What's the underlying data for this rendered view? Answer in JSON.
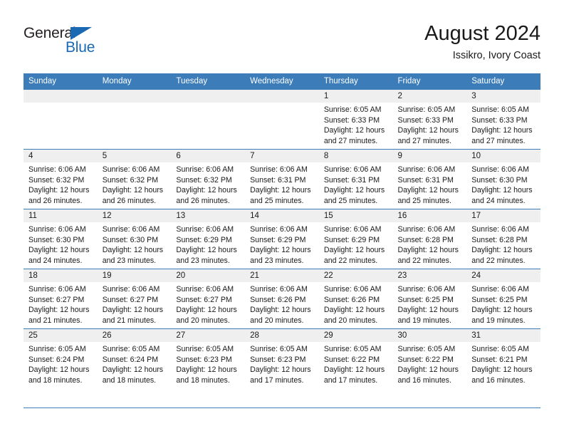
{
  "brand": {
    "name_part1": "General",
    "name_part2": "Blue",
    "color_dark": "#231f20",
    "color_blue": "#1b68b3"
  },
  "header": {
    "title": "August 2024",
    "subtitle": "Issikro, Ivory Coast"
  },
  "theme": {
    "header_row_bg": "#3b7cb9",
    "daynum_bg": "#efefef",
    "rule_color": "#3b7cb9",
    "text_color": "#1a1a1a"
  },
  "weekdays": [
    "Sunday",
    "Monday",
    "Tuesday",
    "Wednesday",
    "Thursday",
    "Friday",
    "Saturday"
  ],
  "weeks": [
    [
      {
        "day": "",
        "sunrise": "",
        "sunset": "",
        "daylight1": "",
        "daylight2": ""
      },
      {
        "day": "",
        "sunrise": "",
        "sunset": "",
        "daylight1": "",
        "daylight2": ""
      },
      {
        "day": "",
        "sunrise": "",
        "sunset": "",
        "daylight1": "",
        "daylight2": ""
      },
      {
        "day": "",
        "sunrise": "",
        "sunset": "",
        "daylight1": "",
        "daylight2": ""
      },
      {
        "day": "1",
        "sunrise": "Sunrise: 6:05 AM",
        "sunset": "Sunset: 6:33 PM",
        "daylight1": "Daylight: 12 hours",
        "daylight2": "and 27 minutes."
      },
      {
        "day": "2",
        "sunrise": "Sunrise: 6:05 AM",
        "sunset": "Sunset: 6:33 PM",
        "daylight1": "Daylight: 12 hours",
        "daylight2": "and 27 minutes."
      },
      {
        "day": "3",
        "sunrise": "Sunrise: 6:05 AM",
        "sunset": "Sunset: 6:33 PM",
        "daylight1": "Daylight: 12 hours",
        "daylight2": "and 27 minutes."
      }
    ],
    [
      {
        "day": "4",
        "sunrise": "Sunrise: 6:06 AM",
        "sunset": "Sunset: 6:32 PM",
        "daylight1": "Daylight: 12 hours",
        "daylight2": "and 26 minutes."
      },
      {
        "day": "5",
        "sunrise": "Sunrise: 6:06 AM",
        "sunset": "Sunset: 6:32 PM",
        "daylight1": "Daylight: 12 hours",
        "daylight2": "and 26 minutes."
      },
      {
        "day": "6",
        "sunrise": "Sunrise: 6:06 AM",
        "sunset": "Sunset: 6:32 PM",
        "daylight1": "Daylight: 12 hours",
        "daylight2": "and 26 minutes."
      },
      {
        "day": "7",
        "sunrise": "Sunrise: 6:06 AM",
        "sunset": "Sunset: 6:31 PM",
        "daylight1": "Daylight: 12 hours",
        "daylight2": "and 25 minutes."
      },
      {
        "day": "8",
        "sunrise": "Sunrise: 6:06 AM",
        "sunset": "Sunset: 6:31 PM",
        "daylight1": "Daylight: 12 hours",
        "daylight2": "and 25 minutes."
      },
      {
        "day": "9",
        "sunrise": "Sunrise: 6:06 AM",
        "sunset": "Sunset: 6:31 PM",
        "daylight1": "Daylight: 12 hours",
        "daylight2": "and 25 minutes."
      },
      {
        "day": "10",
        "sunrise": "Sunrise: 6:06 AM",
        "sunset": "Sunset: 6:30 PM",
        "daylight1": "Daylight: 12 hours",
        "daylight2": "and 24 minutes."
      }
    ],
    [
      {
        "day": "11",
        "sunrise": "Sunrise: 6:06 AM",
        "sunset": "Sunset: 6:30 PM",
        "daylight1": "Daylight: 12 hours",
        "daylight2": "and 24 minutes."
      },
      {
        "day": "12",
        "sunrise": "Sunrise: 6:06 AM",
        "sunset": "Sunset: 6:30 PM",
        "daylight1": "Daylight: 12 hours",
        "daylight2": "and 23 minutes."
      },
      {
        "day": "13",
        "sunrise": "Sunrise: 6:06 AM",
        "sunset": "Sunset: 6:29 PM",
        "daylight1": "Daylight: 12 hours",
        "daylight2": "and 23 minutes."
      },
      {
        "day": "14",
        "sunrise": "Sunrise: 6:06 AM",
        "sunset": "Sunset: 6:29 PM",
        "daylight1": "Daylight: 12 hours",
        "daylight2": "and 23 minutes."
      },
      {
        "day": "15",
        "sunrise": "Sunrise: 6:06 AM",
        "sunset": "Sunset: 6:29 PM",
        "daylight1": "Daylight: 12 hours",
        "daylight2": "and 22 minutes."
      },
      {
        "day": "16",
        "sunrise": "Sunrise: 6:06 AM",
        "sunset": "Sunset: 6:28 PM",
        "daylight1": "Daylight: 12 hours",
        "daylight2": "and 22 minutes."
      },
      {
        "day": "17",
        "sunrise": "Sunrise: 6:06 AM",
        "sunset": "Sunset: 6:28 PM",
        "daylight1": "Daylight: 12 hours",
        "daylight2": "and 22 minutes."
      }
    ],
    [
      {
        "day": "18",
        "sunrise": "Sunrise: 6:06 AM",
        "sunset": "Sunset: 6:27 PM",
        "daylight1": "Daylight: 12 hours",
        "daylight2": "and 21 minutes."
      },
      {
        "day": "19",
        "sunrise": "Sunrise: 6:06 AM",
        "sunset": "Sunset: 6:27 PM",
        "daylight1": "Daylight: 12 hours",
        "daylight2": "and 21 minutes."
      },
      {
        "day": "20",
        "sunrise": "Sunrise: 6:06 AM",
        "sunset": "Sunset: 6:27 PM",
        "daylight1": "Daylight: 12 hours",
        "daylight2": "and 20 minutes."
      },
      {
        "day": "21",
        "sunrise": "Sunrise: 6:06 AM",
        "sunset": "Sunset: 6:26 PM",
        "daylight1": "Daylight: 12 hours",
        "daylight2": "and 20 minutes."
      },
      {
        "day": "22",
        "sunrise": "Sunrise: 6:06 AM",
        "sunset": "Sunset: 6:26 PM",
        "daylight1": "Daylight: 12 hours",
        "daylight2": "and 20 minutes."
      },
      {
        "day": "23",
        "sunrise": "Sunrise: 6:06 AM",
        "sunset": "Sunset: 6:25 PM",
        "daylight1": "Daylight: 12 hours",
        "daylight2": "and 19 minutes."
      },
      {
        "day": "24",
        "sunrise": "Sunrise: 6:06 AM",
        "sunset": "Sunset: 6:25 PM",
        "daylight1": "Daylight: 12 hours",
        "daylight2": "and 19 minutes."
      }
    ],
    [
      {
        "day": "25",
        "sunrise": "Sunrise: 6:05 AM",
        "sunset": "Sunset: 6:24 PM",
        "daylight1": "Daylight: 12 hours",
        "daylight2": "and 18 minutes."
      },
      {
        "day": "26",
        "sunrise": "Sunrise: 6:05 AM",
        "sunset": "Sunset: 6:24 PM",
        "daylight1": "Daylight: 12 hours",
        "daylight2": "and 18 minutes."
      },
      {
        "day": "27",
        "sunrise": "Sunrise: 6:05 AM",
        "sunset": "Sunset: 6:23 PM",
        "daylight1": "Daylight: 12 hours",
        "daylight2": "and 18 minutes."
      },
      {
        "day": "28",
        "sunrise": "Sunrise: 6:05 AM",
        "sunset": "Sunset: 6:23 PM",
        "daylight1": "Daylight: 12 hours",
        "daylight2": "and 17 minutes."
      },
      {
        "day": "29",
        "sunrise": "Sunrise: 6:05 AM",
        "sunset": "Sunset: 6:22 PM",
        "daylight1": "Daylight: 12 hours",
        "daylight2": "and 17 minutes."
      },
      {
        "day": "30",
        "sunrise": "Sunrise: 6:05 AM",
        "sunset": "Sunset: 6:22 PM",
        "daylight1": "Daylight: 12 hours",
        "daylight2": "and 16 minutes."
      },
      {
        "day": "31",
        "sunrise": "Sunrise: 6:05 AM",
        "sunset": "Sunset: 6:21 PM",
        "daylight1": "Daylight: 12 hours",
        "daylight2": "and 16 minutes."
      }
    ]
  ]
}
